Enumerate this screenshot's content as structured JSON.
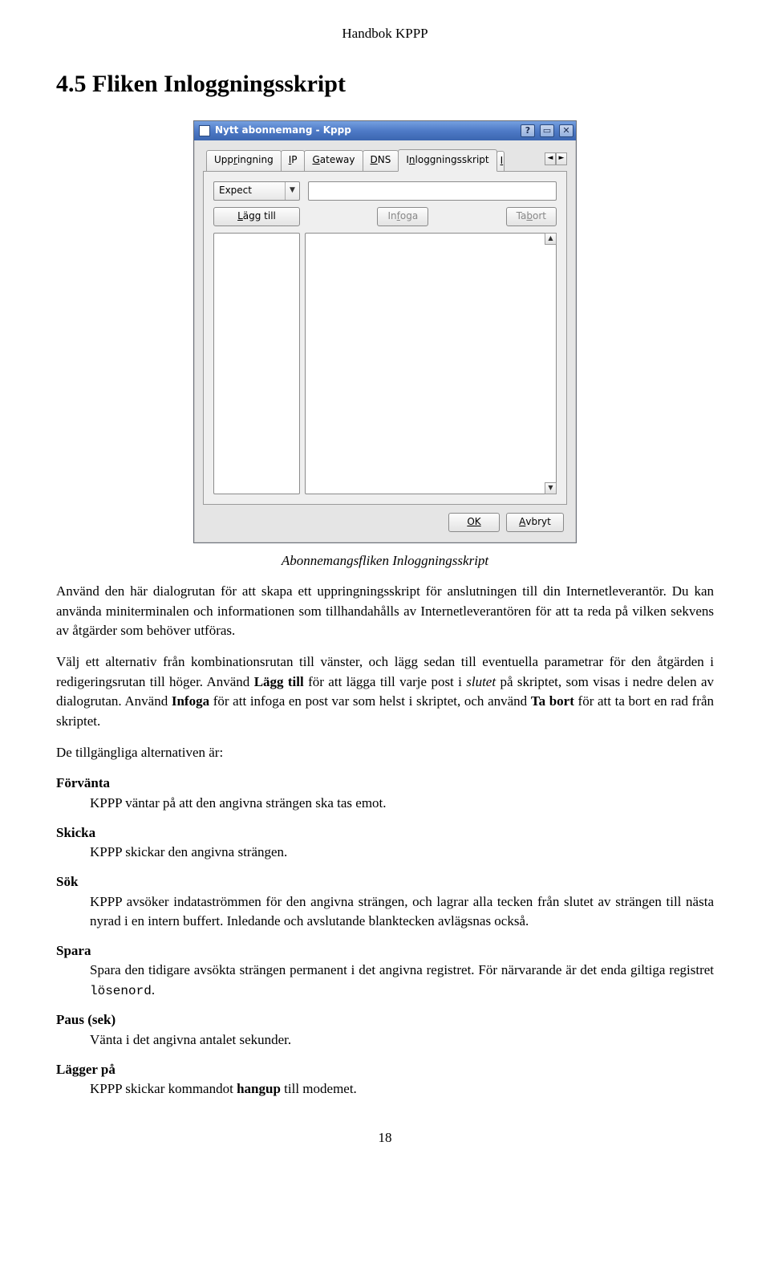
{
  "header": {
    "title": "Handbok KPPP"
  },
  "section": {
    "heading": "4.5   Fliken Inloggningsskript"
  },
  "dialog": {
    "window_title": "Nytt abonnemang - Kppp",
    "tabs": {
      "uppringning": "Uppringning",
      "ip": "IP",
      "gateway": "Gateway",
      "dns": "DNS",
      "inloggningsskript": "Inloggningsskript"
    },
    "controls": {
      "combo_value": "Expect",
      "add": "Lägg till",
      "insert": "Infoga",
      "remove": "Ta bort"
    },
    "buttons": {
      "ok": "OK",
      "cancel": "Avbryt"
    }
  },
  "caption": "Abonnemangsfliken Inloggningsskript",
  "paras": {
    "p1": "Använd den här dialogrutan för att skapa ett uppringningsskript för anslutningen till din Internetleverantör. Du kan använda miniterminalen och informationen som tillhandahålls av Internetleverantören för att ta reda på vilken sekvens av åtgärder som behöver utföras.",
    "p2a": "Välj ett alternativ från kombinationsrutan till vänster, och lägg sedan till eventuella parametrar för den åtgärden i redigeringsrutan till höger. Använd ",
    "p2_bold1": "Lägg till",
    "p2b": " för att lägga till varje post i ",
    "p2_it": "slutet",
    "p2c": " på skriptet, som visas i nedre delen av dialogrutan. Använd ",
    "p2_bold2": "Infoga",
    "p2d": " för att infoga en post var som helst i skriptet, och använd ",
    "p2_bold3": "Ta bort",
    "p2e": " för att ta bort en rad från skriptet.",
    "p3": "De tillgängliga alternativen är:"
  },
  "options": {
    "forvana": {
      "term": "Förvänta",
      "def": "KPPP väntar på att den angivna strängen ska tas emot."
    },
    "skicka": {
      "term": "Skicka",
      "def": "KPPP skickar den angivna strängen."
    },
    "sok": {
      "term": "Sök",
      "def": "KPPP avsöker indataströmmen för den angivna strängen, och lagrar alla tecken från slutet av strängen till nästa nyrad i en intern buffert. Inledande och avslutande blanktecken avlägsnas också."
    },
    "spara": {
      "term": "Spara",
      "def_a": "Spara den tidigare avsökta strängen permanent i det angivna registret. För närvarande är det enda giltiga registret ",
      "def_code": "lösenord",
      "def_b": "."
    },
    "paus": {
      "term": "Paus (sek)",
      "def": "Vänta i det angivna antalet sekunder."
    },
    "lagger": {
      "term": "Lägger på",
      "def_a": "KPPP skickar kommandot ",
      "def_bold": "hangup",
      "def_b": " till modemet."
    }
  },
  "page_number": "18"
}
